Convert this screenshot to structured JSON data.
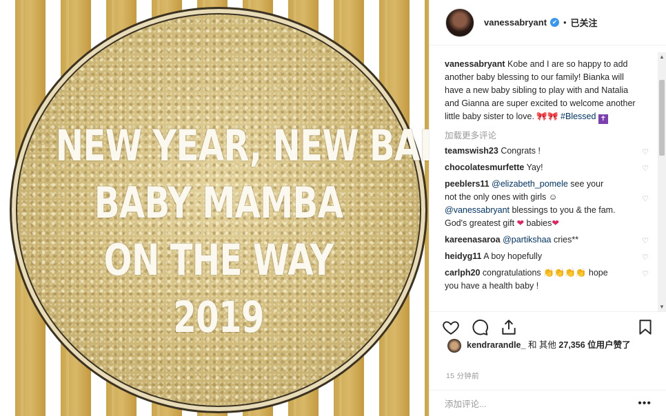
{
  "photo": {
    "lines": [
      "NEW YEAR, NEW BABY!",
      "BABY MAMBA",
      "ON THE WAY",
      "2019"
    ]
  },
  "header": {
    "username": "vanessabryant",
    "verified_glyph": "✔",
    "separator": "•",
    "follow_status": "已关注"
  },
  "caption": {
    "username": "vanessabryant",
    "text": "Kobe and I are so happy to add another baby blessing to our family! Bianka will have a new baby sibling to play with and Natalia and Gianna are super excited to welcome another little baby sister to love.",
    "emojis": "🎀🎀",
    "hashtag": "#Blessed",
    "prayer_icon": "✝"
  },
  "load_more": "加载更多评论",
  "comments": [
    {
      "user": "teamswish23",
      "text": "Congrats !"
    },
    {
      "user": "chocolatesmurfette",
      "text": "Yay!"
    },
    {
      "user": "peeblers11",
      "mention": "@elizabeth_pomele",
      "text": " see your not the only ones with girls ☺",
      "mention2": "@vanessabryant",
      "text2": " blessings to you & the fam. God's greatest gift ",
      "heart": "❤",
      "text3": " babies",
      "heart2": "❤"
    },
    {
      "user": "kareenasaroa",
      "mention": "@partikshaa",
      "text": " cries**"
    },
    {
      "user": "heidyg11",
      "text": "A boy hopefully"
    },
    {
      "user": "carlph20",
      "text": "congratulations 👏👏👏👏 hope you have a health baby !"
    }
  ],
  "heart_icon": "♡",
  "likes": {
    "user": "kendrarandle_",
    "and": "和 其他",
    "count": "27,356",
    "suffix": "位用户赞了"
  },
  "time": "15 分钟前",
  "add_comment": {
    "placeholder": "添加评论...",
    "more_glyph": "•••"
  }
}
